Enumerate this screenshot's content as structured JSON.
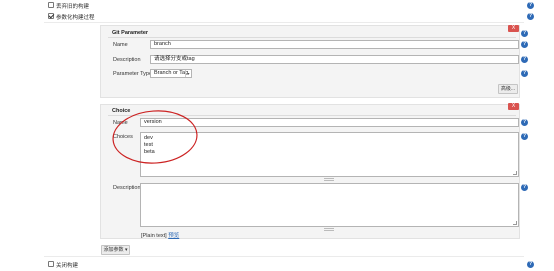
{
  "options": {
    "discard_old_builds": "丢弃旧的构建",
    "parameterized_build": "参数化构建过程",
    "disable_build": "关闭构建"
  },
  "git_parameter": {
    "title": "Git Parameter",
    "delete_label": "X",
    "name_label": "Name",
    "name_value": "branch",
    "description_label": "Description",
    "description_value": "请选择分支或tag",
    "parameter_type_label": "Parameter Type",
    "parameter_type_value": "Branch or Tag",
    "advanced_button": "高级..."
  },
  "choice": {
    "title": "Choice",
    "delete_label": "X",
    "name_label": "Name",
    "name_value": "version",
    "choices_label": "Choices",
    "choices": [
      "dev",
      "test",
      "beta"
    ],
    "description_label": "Description",
    "description_value": "",
    "format_plain": "[Plain text]",
    "format_preview": "预览"
  },
  "add_parameter_button": "添加参数",
  "icons": {
    "help": "help-icon",
    "dropdown": "chevron-down-icon"
  },
  "colors": {
    "help_blue": "#2e6ab6",
    "delete_red": "#d9534f",
    "annotation_red": "#cc2222"
  }
}
